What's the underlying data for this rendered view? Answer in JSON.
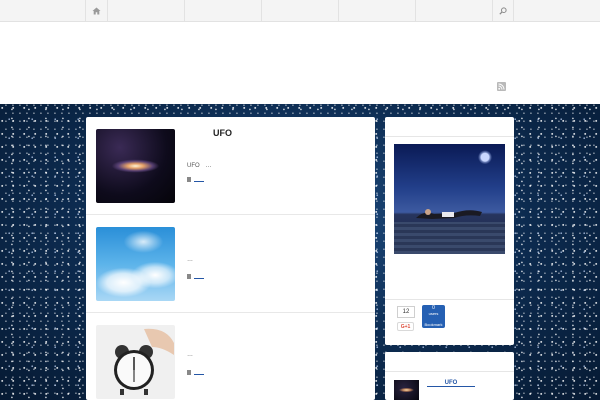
{
  "nav": {
    "home_icon": "home-icon",
    "search_icon": "search-icon"
  },
  "header": {
    "rss_icon": "rss-icon"
  },
  "posts": [
    {
      "title": "UFO",
      "excerpt": "UFO　…",
      "thumb": "galaxy"
    },
    {
      "title": "",
      "excerpt": "…",
      "thumb": "sky"
    },
    {
      "title": "",
      "excerpt": "…",
      "thumb": "alarm-clock"
    }
  ],
  "sidebar": {
    "share_count": "12",
    "bookmark_count": "0",
    "bookmark_unit": "users",
    "bookmark_label": "Bookmark",
    "gplus_label": "G+1",
    "related_title": "UFO"
  },
  "colors": {
    "background_space": "#0b2748",
    "link": "#2456a6",
    "bookmark": "#2560b3",
    "gplus": "#dd4b39"
  }
}
